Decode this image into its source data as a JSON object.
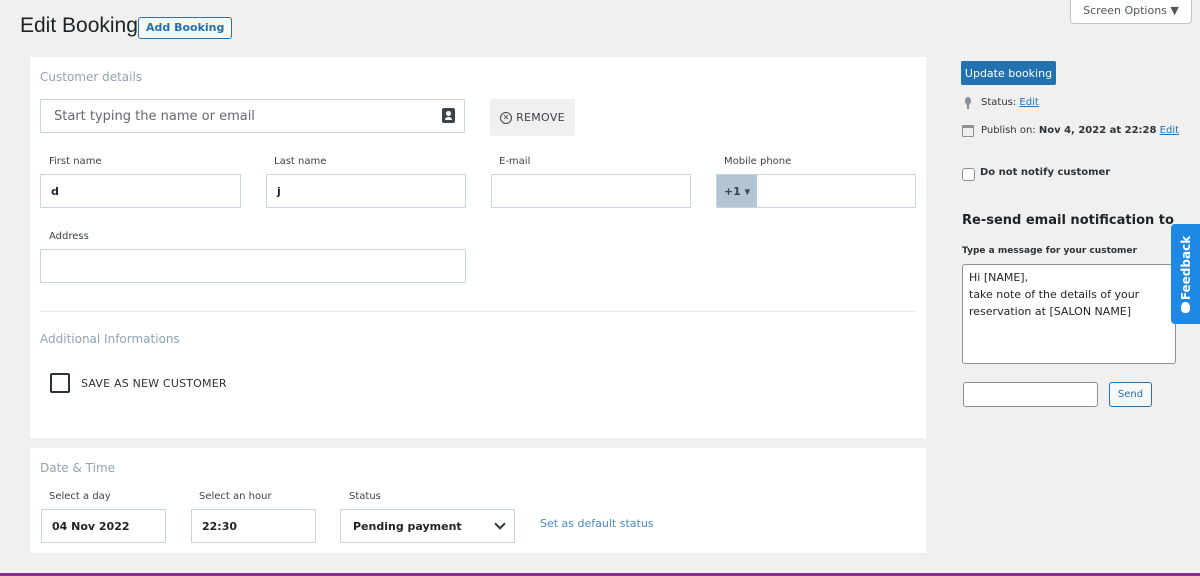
{
  "header": {
    "title": "Edit Booking",
    "add_button": "Add Booking",
    "screen_options": "Screen Options ▼"
  },
  "customer": {
    "section_label": "Customer details",
    "search_placeholder": "Start typing the name or email",
    "remove_label": "REMOVE",
    "first_name_label": "First name",
    "first_name_value": "d",
    "last_name_label": "Last name",
    "last_name_value": "j",
    "email_label": "E-mail",
    "email_value": "",
    "phone_label": "Mobile phone",
    "phone_prefix": "+1 ▾",
    "phone_value": "",
    "address_label": "Address",
    "address_value": ""
  },
  "additional": {
    "section_label": "Additional Informations",
    "save_customer_label": "SAVE AS NEW CUSTOMER"
  },
  "datetime": {
    "section_label": "Date & Time",
    "day_label": "Select a day",
    "day_value": "04 Nov 2022",
    "hour_label": "Select an hour",
    "hour_value": "22:30",
    "status_label": "Status",
    "status_value": "Pending payment",
    "default_status_link": "Set as default status"
  },
  "sidebar": {
    "update_button": "Update booking",
    "status_prefix": "Status:",
    "status_edit": "Edit",
    "publish_prefix": "Publish on:",
    "publish_date": "Nov 4, 2022 at 22:28",
    "publish_edit": "Edit",
    "notify_label": "Do not notify customer",
    "resend_title": "Re-send email notification to",
    "message_label": "Type a message for your customer",
    "message_text": "Hi [NAME],\ntake note of the details of your\nreservation at [SALON NAME]",
    "send_button": "Send"
  },
  "feedback": {
    "label": "Feedback"
  },
  "colors": {
    "primary": "#2271b1",
    "feedback": "#1e88e5",
    "section_label": "#8fa3b6",
    "phone_prefix_bg": "#b3c4d3"
  }
}
